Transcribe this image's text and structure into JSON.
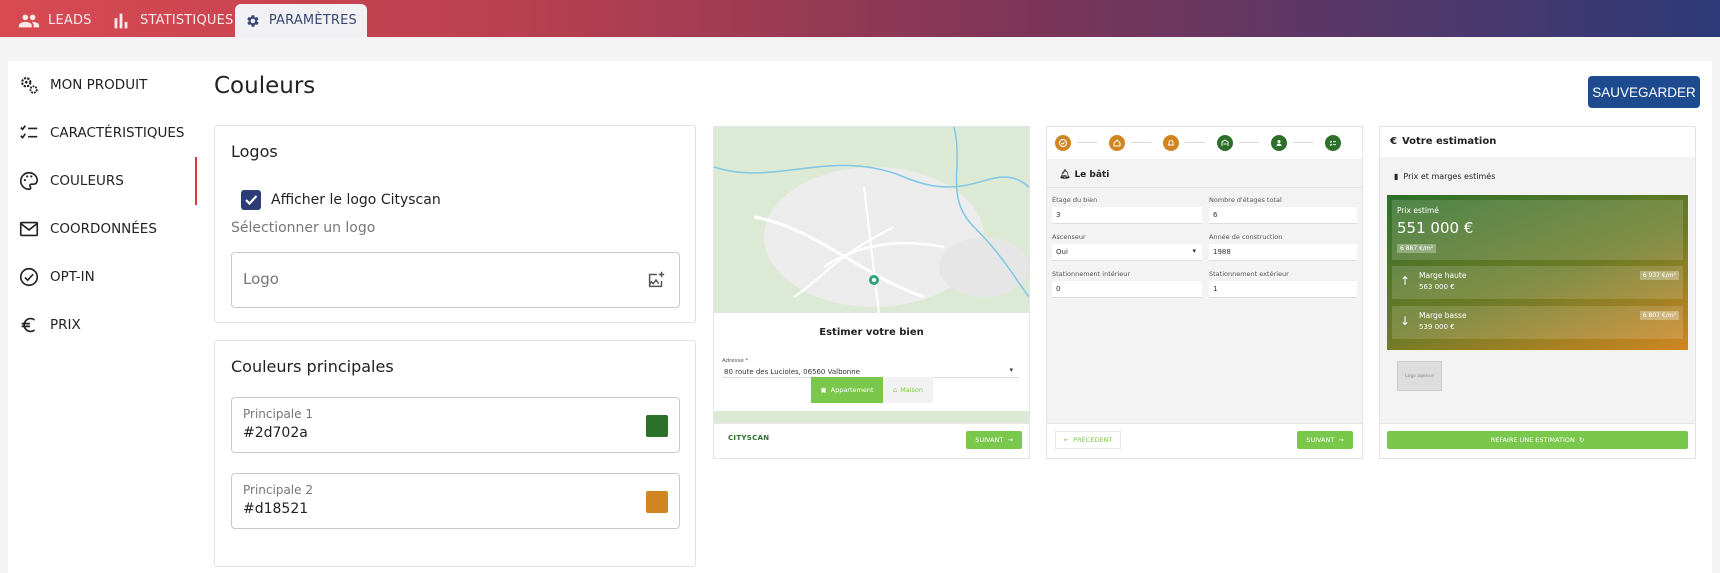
{
  "nav": {
    "tabs": [
      {
        "label": "LEADS",
        "icon": "people-icon"
      },
      {
        "label": "STATISTIQUES",
        "icon": "bar-chart-icon"
      },
      {
        "label": "PARAMÈTRES",
        "icon": "gear-icon"
      }
    ],
    "active_tab": "PARAMÈTRES"
  },
  "sidebar": {
    "items": [
      {
        "label": "MON PRODUIT",
        "icon": "gears-icon"
      },
      {
        "label": "CARACTÉRISTIQUES",
        "icon": "checklist-icon"
      },
      {
        "label": "COULEURS",
        "icon": "palette-icon"
      },
      {
        "label": "COORDONNÉES",
        "icon": "mail-icon"
      },
      {
        "label": "OPT-IN",
        "icon": "check-circle-icon"
      },
      {
        "label": "PRIX",
        "icon": "euro-icon"
      }
    ],
    "active": "COULEURS"
  },
  "page": {
    "title": "Couleurs",
    "save_label": "SAUVEGARDER"
  },
  "logos": {
    "title": "Logos",
    "checkbox_label": "Afficher le logo Cityscan",
    "checkbox_checked": true,
    "select_label": "Sélectionner un logo",
    "logo_placeholder": "Logo"
  },
  "colors": {
    "title": "Couleurs principales",
    "primary1": {
      "label": "Principale 1",
      "value": "#2d702a"
    },
    "primary2": {
      "label": "Principale 2",
      "value": "#d18521"
    }
  },
  "preview1": {
    "title": "Estimer votre bien",
    "address_label": "Adresse *",
    "address_value": "80 route des Lucioles, 06560 Valbonne",
    "type_options": [
      "Appartement",
      "Maison"
    ],
    "selected_type": "Appartement",
    "brand": "CITYSCAN",
    "next_label": "SUIVANT"
  },
  "preview2": {
    "section_title": "Le bâti",
    "fields": [
      {
        "label": "Étage du bien",
        "value": "3"
      },
      {
        "label": "Nombre d'étages total",
        "value": "6"
      },
      {
        "label": "Ascenseur",
        "value": "Oui"
      },
      {
        "label": "Année de construction",
        "value": "1988"
      },
      {
        "label": "Stationnement intérieur",
        "value": "0"
      },
      {
        "label": "Stationnement extérieur",
        "value": "1"
      }
    ],
    "prev_label": "PRÉCÉDENT",
    "next_label": "SUIVANT"
  },
  "preview3": {
    "title": "Votre estimation",
    "subtitle": "Prix et marges estimés",
    "price_label": "Prix estimé",
    "price": "551 000 €",
    "price_m2": "6 887 €/m²",
    "high_label": "Marge haute",
    "high_value": "563 000 €",
    "high_m2": "6 937 €/m²",
    "low_label": "Marge basse",
    "low_value": "539 000 €",
    "low_m2": "6 807 €/m²",
    "logo_text": "Logo agence",
    "redo_label": "REFAIRE UNE ESTIMATION"
  },
  "theme": {
    "primary1": "#2d702a",
    "primary2": "#d18521",
    "accent": "#7ac84b",
    "brand_blue": "#1e4b8f"
  }
}
